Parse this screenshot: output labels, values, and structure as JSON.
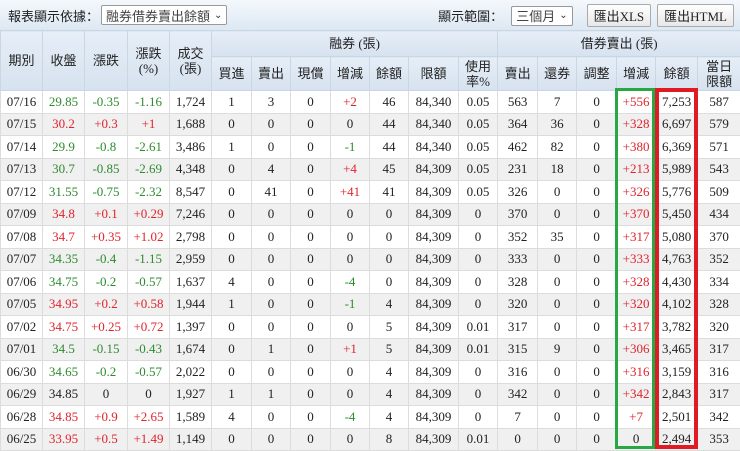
{
  "toolbar": {
    "basis_label": "報表顯示依據：",
    "basis_value": "融券借券賣出餘額",
    "range_label": "顯示範圍：",
    "range_value": "三個月",
    "export_xls": "匯出XLS",
    "export_html": "匯出HTML"
  },
  "headers": {
    "date": "期別",
    "close": "收盤",
    "change": "漲跌",
    "change_pct": "漲跌\n(%)",
    "volume": "成交\n(張)",
    "margin_group": "融券 (張)",
    "sbl_group": "借券賣出 (張)",
    "margin_cols": [
      "買進",
      "賣出",
      "現償",
      "增減",
      "餘額",
      "限額",
      "使用\n率%"
    ],
    "sbl_cols": [
      "賣出",
      "還券",
      "調整",
      "增減",
      "餘額",
      "當日\n限額"
    ]
  },
  "colors": {
    "up": "#e0242c",
    "down": "#2e8b2e",
    "highlight_change": "#27a844",
    "highlight_balance": "#e01b24"
  },
  "rows": [
    [
      "07/16",
      "29.85",
      "-0.35",
      "-1.16",
      "1,724",
      "1",
      "3",
      "0",
      "+2",
      "46",
      "84,340",
      "0.05",
      "563",
      "7",
      "0",
      "+556",
      "7,253",
      "587"
    ],
    [
      "07/15",
      "30.2",
      "+0.3",
      "+1",
      "1,688",
      "0",
      "0",
      "0",
      "0",
      "44",
      "84,340",
      "0.05",
      "364",
      "36",
      "0",
      "+328",
      "6,697",
      "579"
    ],
    [
      "07/14",
      "29.9",
      "-0.8",
      "-2.61",
      "3,486",
      "1",
      "0",
      "0",
      "-1",
      "44",
      "84,340",
      "0.05",
      "462",
      "82",
      "0",
      "+380",
      "6,369",
      "571"
    ],
    [
      "07/13",
      "30.7",
      "-0.85",
      "-2.69",
      "4,348",
      "0",
      "4",
      "0",
      "+4",
      "45",
      "84,309",
      "0.05",
      "231",
      "18",
      "0",
      "+213",
      "5,989",
      "543"
    ],
    [
      "07/12",
      "31.55",
      "-0.75",
      "-2.32",
      "8,547",
      "0",
      "41",
      "0",
      "+41",
      "41",
      "84,309",
      "0.05",
      "326",
      "0",
      "0",
      "+326",
      "5,776",
      "509"
    ],
    [
      "07/09",
      "34.8",
      "+0.1",
      "+0.29",
      "7,246",
      "0",
      "0",
      "0",
      "0",
      "0",
      "84,309",
      "0",
      "370",
      "0",
      "0",
      "+370",
      "5,450",
      "434"
    ],
    [
      "07/08",
      "34.7",
      "+0.35",
      "+1.02",
      "2,798",
      "0",
      "0",
      "0",
      "0",
      "0",
      "84,309",
      "0",
      "352",
      "35",
      "0",
      "+317",
      "5,080",
      "370"
    ],
    [
      "07/07",
      "34.35",
      "-0.4",
      "-1.15",
      "2,959",
      "0",
      "0",
      "0",
      "0",
      "0",
      "84,309",
      "0",
      "333",
      "0",
      "0",
      "+333",
      "4,763",
      "352"
    ],
    [
      "07/06",
      "34.75",
      "-0.2",
      "-0.57",
      "1,637",
      "4",
      "0",
      "0",
      "-4",
      "0",
      "84,309",
      "0",
      "328",
      "0",
      "0",
      "+328",
      "4,430",
      "334"
    ],
    [
      "07/05",
      "34.95",
      "+0.2",
      "+0.58",
      "1,944",
      "1",
      "0",
      "0",
      "-1",
      "4",
      "84,309",
      "0",
      "320",
      "0",
      "0",
      "+320",
      "4,102",
      "328"
    ],
    [
      "07/02",
      "34.75",
      "+0.25",
      "+0.72",
      "1,397",
      "0",
      "0",
      "0",
      "0",
      "5",
      "84,309",
      "0.01",
      "317",
      "0",
      "0",
      "+317",
      "3,782",
      "320"
    ],
    [
      "07/01",
      "34.5",
      "-0.15",
      "-0.43",
      "1,674",
      "0",
      "1",
      "0",
      "+1",
      "5",
      "84,309",
      "0.01",
      "315",
      "9",
      "0",
      "+306",
      "3,465",
      "317"
    ],
    [
      "06/30",
      "34.65",
      "-0.2",
      "-0.57",
      "2,022",
      "0",
      "0",
      "0",
      "0",
      "4",
      "84,309",
      "0",
      "316",
      "0",
      "0",
      "+316",
      "3,159",
      "316"
    ],
    [
      "06/29",
      "34.85",
      "0",
      "0",
      "1,927",
      "1",
      "1",
      "0",
      "0",
      "4",
      "84,309",
      "0",
      "342",
      "0",
      "0",
      "+342",
      "2,843",
      "317"
    ],
    [
      "06/28",
      "34.85",
      "+0.9",
      "+2.65",
      "1,589",
      "4",
      "0",
      "0",
      "-4",
      "4",
      "84,309",
      "0",
      "7",
      "0",
      "0",
      "+7",
      "2,501",
      "342"
    ],
    [
      "06/25",
      "33.95",
      "+0.5",
      "+1.49",
      "1,149",
      "0",
      "0",
      "0",
      "0",
      "8",
      "84,309",
      "0.01",
      "0",
      "0",
      "0",
      "0",
      "2,494",
      "353"
    ]
  ]
}
